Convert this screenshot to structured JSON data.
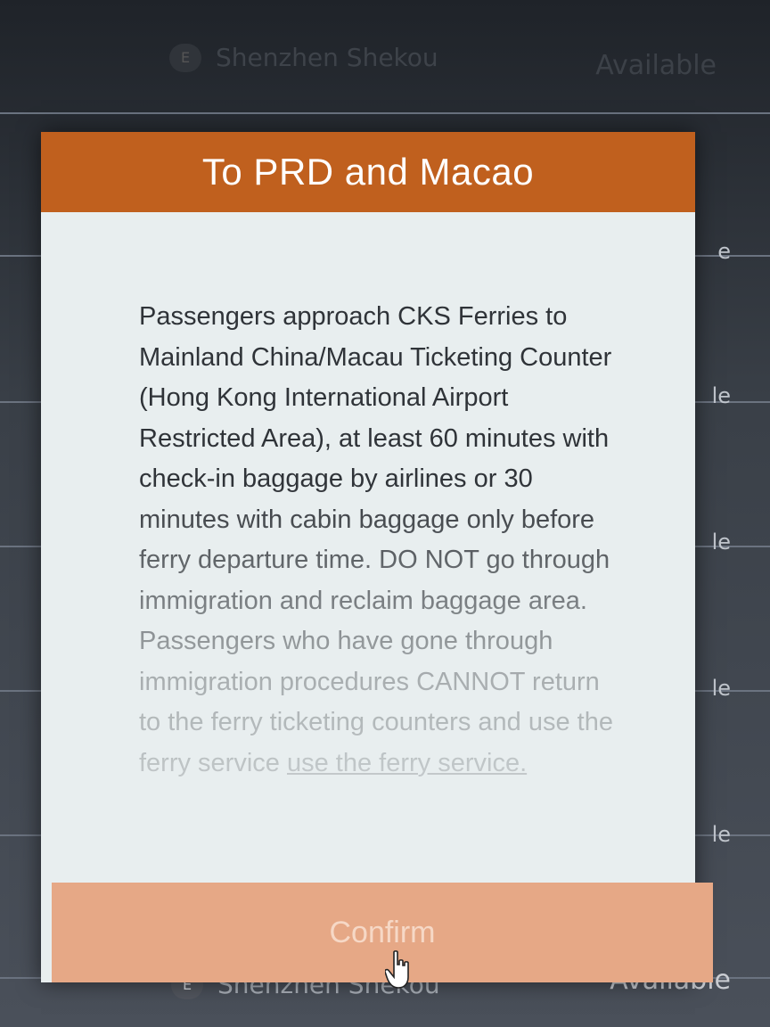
{
  "background": {
    "top_row": {
      "badge": "E",
      "route": "Shenzhen Shekou",
      "status": "Available"
    },
    "side_tails": [
      "e",
      "le",
      "le",
      "le",
      "le"
    ],
    "bottom_row": {
      "badge": "E",
      "route": "Shenzhen Shekou",
      "status": "Available"
    }
  },
  "modal": {
    "title": "To PRD and Macao",
    "body": "Passengers approach CKS Ferries to Mainland China/Macau Ticketing Counter (Hong Kong International Airport Restricted Area), at least 60 minutes with check-in baggage by airlines or 30 minutes with cabin baggage only before ferry departure time. DO NOT go through immigration and reclaim baggage area. Passengers who have gone through immigration procedures CANNOT return to the ferry ticketing counters and use the ferry service ",
    "link": "use the ferry service.",
    "confirm_label": "Confirm",
    "header_color": "#c0601e",
    "footer_color": "#e6a886"
  },
  "icons": {
    "cursor": "hand-pointer-icon"
  }
}
